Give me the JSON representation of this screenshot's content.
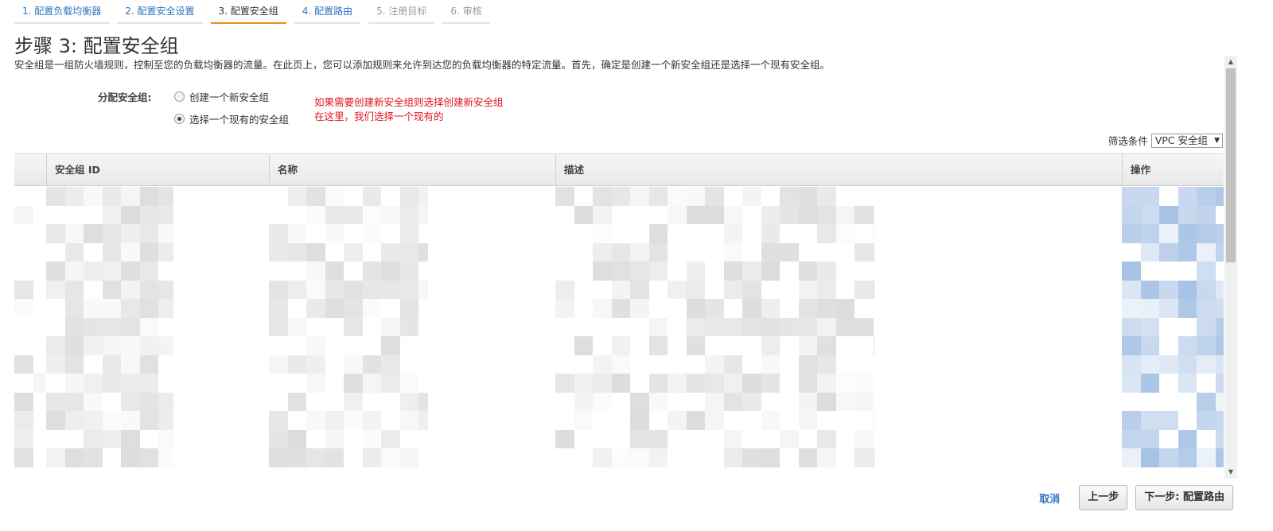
{
  "steps": [
    {
      "label": "1. 配置负载均衡器",
      "state": "link"
    },
    {
      "label": "2. 配置安全设置",
      "state": "link"
    },
    {
      "label": "3. 配置安全组",
      "state": "active"
    },
    {
      "label": "4. 配置路由",
      "state": "link"
    },
    {
      "label": "5. 注册目标",
      "state": "disabled"
    },
    {
      "label": "6. 审核",
      "state": "disabled"
    }
  ],
  "page": {
    "title": "步骤 3: 配置安全组",
    "description": "安全组是一组防火墙规则，控制至您的负载均衡器的流量。在此页上，您可以添加规则来允许到达您的负载均衡器的特定流量。首先，确定是创建一个新安全组还是选择一个现有安全组。"
  },
  "assign": {
    "label": "分配安全组:",
    "option_new": "创建一个新安全组",
    "option_existing": "选择一个现有的安全组",
    "selected": "existing"
  },
  "annotations": {
    "line1": "如果需要创建新安全组则选择创建新安全组",
    "line2": "在这里，我们选择一个现有的"
  },
  "filter": {
    "label": "筛选条件",
    "value": "VPC 安全组"
  },
  "table": {
    "columns": [
      "",
      "安全组 ID",
      "名称",
      "描述",
      "操作"
    ]
  },
  "footer": {
    "cancel": "取消",
    "previous": "上一步",
    "next": "下一步: 配置路由"
  },
  "colors": {
    "link": "#2b74c0",
    "active_tab_underline": "#ec8c21",
    "annotation": "#e0141b"
  }
}
